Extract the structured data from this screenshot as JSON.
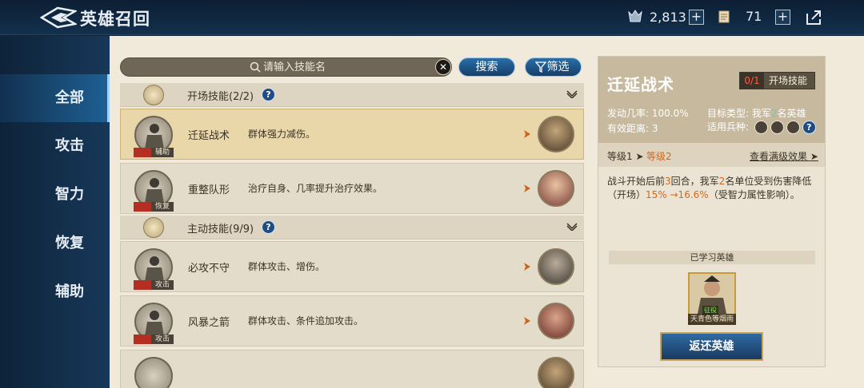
{
  "header": {
    "title": "英雄召回",
    "resource1_value": "2,813",
    "resource2_value": "71",
    "plus_label": "+"
  },
  "sidebar": {
    "items": [
      {
        "label": "全部",
        "active": true
      },
      {
        "label": "攻击"
      },
      {
        "label": "智力"
      },
      {
        "label": "恢复"
      },
      {
        "label": "辅助"
      }
    ]
  },
  "search": {
    "placeholder": "请输入技能名",
    "clear_label": "✕",
    "search_button": "搜索",
    "filter_button": "筛选"
  },
  "groups": [
    {
      "title": "开场技能(2/2)"
    },
    {
      "title": "主动技能(9/9)"
    }
  ],
  "skills": [
    {
      "name": "迁延战术",
      "desc": "群体强力减伤。",
      "tag": "辅助"
    },
    {
      "name": "重整队形",
      "desc": "治疗自身、几率提升治疗效果。",
      "tag": "恢复"
    },
    {
      "name": "必攻不守",
      "desc": "群体攻击、增伤。",
      "tag": "攻击"
    },
    {
      "name": "风暴之箭",
      "desc": "群体攻击、条件追加攻击。",
      "tag": "攻击"
    }
  ],
  "help_label": "?",
  "detail": {
    "title": "迁延战术",
    "slot_count": "0/1",
    "slot_type": "开场技能",
    "trigger_label": "发动几率:",
    "trigger_value": "100.0%",
    "range_label": "有效距离:",
    "range_value": "3",
    "target_label": "目标类型:",
    "target_prefix": "我军",
    "target_num": "2",
    "target_suffix": "名英雄",
    "troop_label": "适用兵种:",
    "level1": "等级1",
    "level_arrow": "➤",
    "level2": "等级2",
    "max_link": "查看满级效果",
    "desc_a": "战斗开始后前",
    "desc_b": "3",
    "desc_c": "回合，我军",
    "desc_d": "2",
    "desc_e": "名单位受到伤害降低（开场）",
    "desc_f": "15% →16.6%",
    "desc_g": "（受智力属性影响）。",
    "learned_title": "已学习英雄",
    "learned_hero_caption": "天青色等烟雨",
    "learned_hero_tag": "征役",
    "return_button": "返还英雄"
  },
  "colors": {
    "accent_orange": "#d4681a",
    "highlight_teal": "#3fe0c6",
    "button_blue": "#2a6ea8",
    "sidebar_active": "#1e5f93"
  },
  "icons": [
    "back-logo-icon",
    "crest-icon",
    "scroll-icon",
    "share-icon",
    "search-icon",
    "filter-icon",
    "chevron-down-icon",
    "arrow-right-icon",
    "troop-sword-icon",
    "troop-target-icon",
    "troop-horse-icon"
  ]
}
